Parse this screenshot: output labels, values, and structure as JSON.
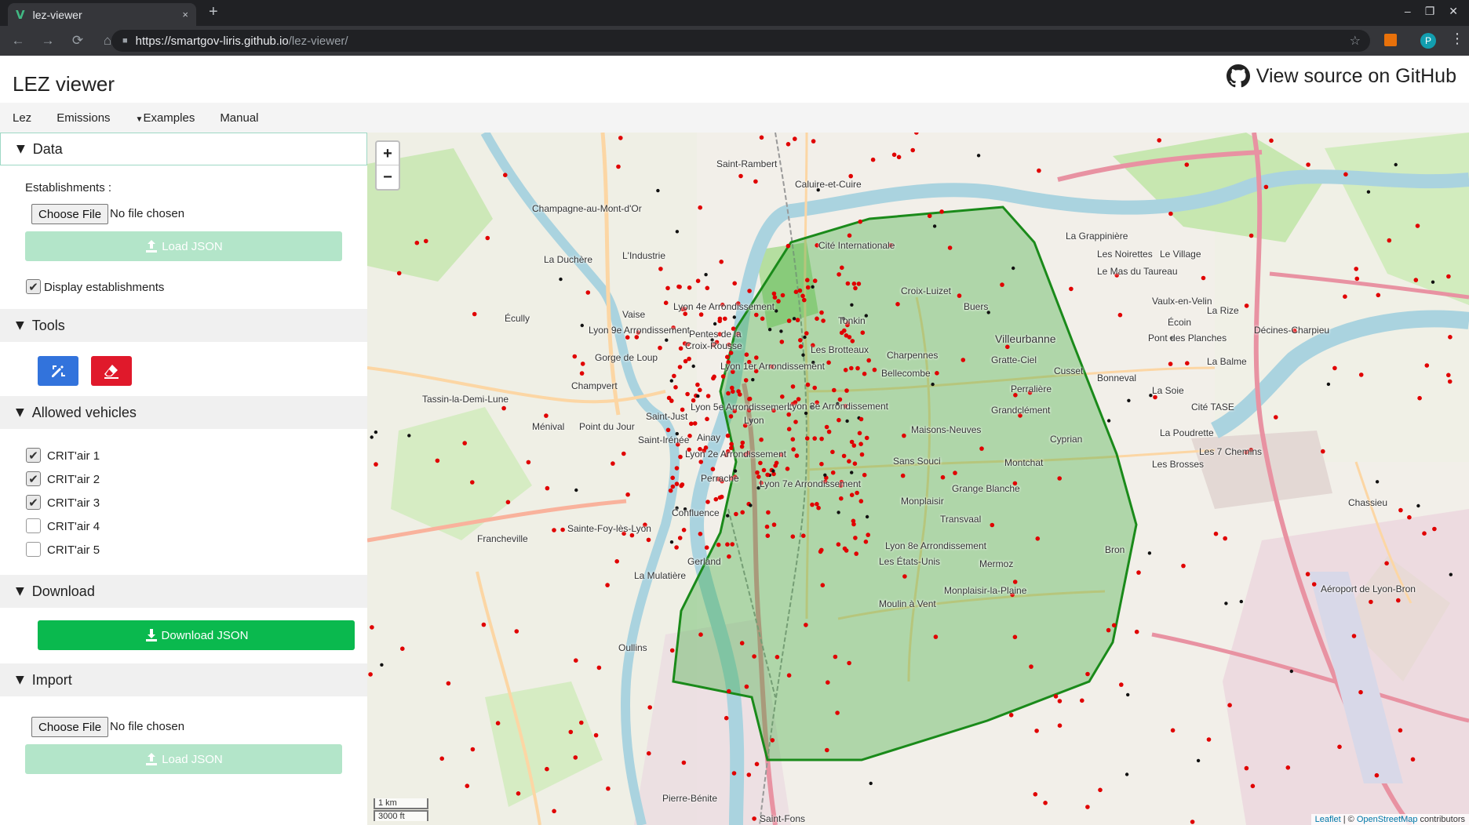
{
  "browser": {
    "tab_title": "lez-viewer",
    "tab_close": "×",
    "new_tab": "+",
    "url_host": "https://smartgov-liris.github.io",
    "url_path": "/lez-viewer/"
  },
  "app": {
    "title": "LEZ viewer",
    "github_link": "View source on GitHub"
  },
  "menu": {
    "lez": "Lez",
    "emissions": "Emissions",
    "examples": "Examples",
    "manual": "Manual"
  },
  "data_section": {
    "title": "Data",
    "establishments_label": "Establishments :",
    "choose_file": "Choose File",
    "no_file": "No file chosen",
    "load_json": "Load JSON",
    "display_establishments": "Display establishments",
    "display_checked": true
  },
  "tools_section": {
    "title": "Tools",
    "draw_icon": "draw-polygon-icon",
    "erase_icon": "eraser-icon",
    "draw_color": "#3273dc",
    "erase_color": "#e0192b"
  },
  "vehicles_section": {
    "title": "Allowed vehicles",
    "items": [
      {
        "label": "CRIT'air 1",
        "checked": true
      },
      {
        "label": "CRIT'air 2",
        "checked": true
      },
      {
        "label": "CRIT'air 3",
        "checked": true
      },
      {
        "label": "CRIT'air 4",
        "checked": false
      },
      {
        "label": "CRIT'air 5",
        "checked": false
      }
    ]
  },
  "download_section": {
    "title": "Download",
    "button": "Download JSON"
  },
  "import_section": {
    "title": "Import",
    "choose_file": "Choose File",
    "no_file": "No file chosen",
    "load_json": "Load JSON"
  },
  "map": {
    "zoom_in": "+",
    "zoom_out": "−",
    "scale_km": "1 km",
    "scale_ft": "3000 ft",
    "attribution_leaflet": "Leaflet",
    "attribution_sep": " | © ",
    "attribution_osm": "OpenStreetMap",
    "attribution_tail": " contributors",
    "zone_color": "#1a8a1a",
    "labels": {
      "l1": "Saint-Rambert",
      "l2": "Caluire-et-Cuire",
      "l3": "Cité Internationale",
      "l4": "Lyon 4e Arrondissement",
      "l5": "Lyon 9e Arrondissement",
      "l6": "Lyon 1er Arrondissement",
      "l7": "Lyon 5e Arrondissement",
      "l8": "Lyon 3e Arrondissement",
      "l9": "Lyon",
      "l10": "Lyon 2e Arrondissement",
      "l11": "Lyon 7e Arrondissement",
      "l12": "Lyon 8e Arrondissement",
      "l13": "Villeurbanne",
      "l14": "Gratte-Ciel",
      "l15": "Les Brotteaux",
      "l16": "Charpennes",
      "l17": "Bellecombe",
      "l18": "Maisons-Neuves",
      "l19": "Sans Souci",
      "l20": "Montchat",
      "l21": "Grange Blanche",
      "l22": "Monplaisir",
      "l23": "Transvaal",
      "l24": "Les États-Unis",
      "l25": "Mermoz",
      "l26": "Gerland",
      "l27": "Moulin à Vent",
      "l28": "Confluence",
      "l29": "Perrache",
      "l30": "Sainte-Foy-lès-Lyon",
      "l31": "Francheville",
      "l32": "Oullins",
      "l33": "La Mulatière",
      "l34": "Tassin-la-Demi-Lune",
      "l35": "Écully",
      "l36": "Champvert",
      "l37": "Vaise",
      "l38": "Gorge de Loup",
      "l39": "Saint-Just",
      "l40": "Saint-Irénée",
      "l41": "Ménival",
      "l42": "Point du Jour",
      "l43": "Bron",
      "l44": "Vaulx-en-Velin",
      "l45": "Décines-Charpieu",
      "l46": "Chassieu",
      "l47": "La Grappinière",
      "l48": "Les Noirettes",
      "l49": "Le Village",
      "l50": "Le Mas du Taureau",
      "l51": "Cusset",
      "l52": "Bonneval",
      "l53": "Perralière",
      "l54": "Grandclément",
      "l55": "Cyprian",
      "l56": "La Soie",
      "l57": "Cité TASE",
      "l58": "La Poudrette",
      "l59": "Les 7 Chemins",
      "l60": "Les Brosses",
      "l61": "La Balme",
      "l62": "Pont des Planches",
      "l63": "Écoin",
      "l64": "La Rize",
      "l65": "Croix-Luizet",
      "l66": "Buers",
      "l67": "Tonkin",
      "l68": "Saint-Fons",
      "l69": "Pierre-Bénite",
      "l70": "Monplaisir-la-Plaine",
      "l71": "Aéroport de Lyon-Bron",
      "l72": "La Duchère",
      "l73": "L'Industrie",
      "l74": "Champagne-au-Mont-d'Or",
      "l75": "Croix-Rousse",
      "l76": "Pentes de la",
      "l77": "Ainay"
    }
  }
}
